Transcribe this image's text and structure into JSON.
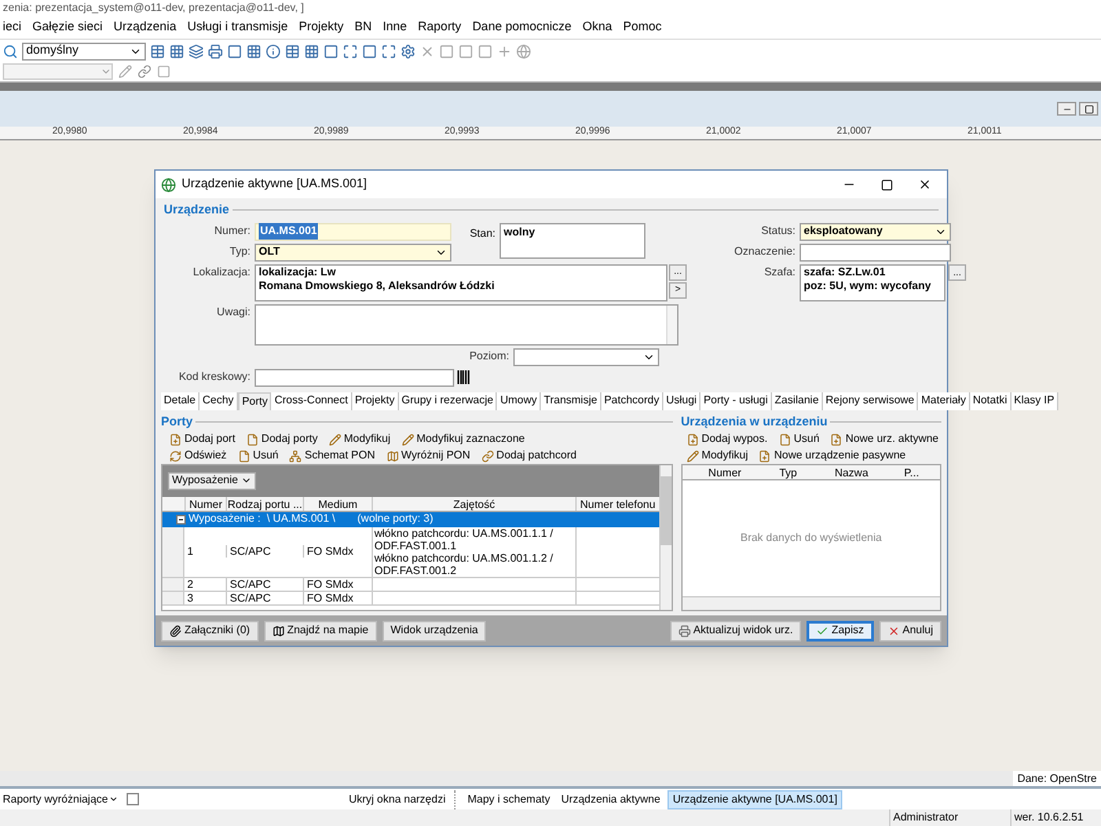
{
  "window": {
    "title": "zenia: prezentacja_system@o11-dev, prezentacja@o11-dev, ]"
  },
  "menu": [
    "ieci",
    "Gałęzie sieci",
    "Urządzenia",
    "Usługi i transmisje",
    "Projekty",
    "BN",
    "Inne",
    "Raporty",
    "Dane pomocnicze",
    "Okna",
    "Pomoc"
  ],
  "toolbar": {
    "profile": "domyślny"
  },
  "ruler": [
    "20,9980",
    "20,9984",
    "20,9989",
    "20,9993",
    "20,9996",
    "21,0002",
    "21,0007",
    "21,0011"
  ],
  "dialog": {
    "title": "Urządzenie aktywne [UA.MS.001]",
    "group": "Urządzenie",
    "fields": {
      "numer": {
        "label": "Numer:",
        "value": "UA.MS.001"
      },
      "typ": {
        "label": "Typ:",
        "value": "OLT"
      },
      "stan": {
        "label": "Stan:",
        "value": "wolny"
      },
      "status": {
        "label": "Status:",
        "value": "eksploatowany"
      },
      "oznaczenie": {
        "label": "Oznaczenie:"
      },
      "lokalizacja": {
        "label": "Lokalizacja:",
        "buttons": [
          "...",
          ">"
        ],
        "lines": [
          "lokalizacja: Lw",
          "Romana Dmowskiego 8, Aleksandrów Łódzki"
        ]
      },
      "szafa": {
        "label": "Szafa:",
        "button": "...",
        "lines": [
          "szafa: SZ.Lw.01",
          "poz: 5U,  wym: wycofany"
        ]
      },
      "uwagi": {
        "label": "Uwagi:"
      },
      "poziom": {
        "label": "Poziom:"
      },
      "kod": {
        "label": "Kod kreskowy:"
      }
    },
    "tabs": [
      {
        "label": "Detale",
        "selected": false
      },
      {
        "label": "Cechy",
        "selected": false
      },
      {
        "label": "Porty",
        "selected": true
      },
      {
        "label": "Cross-Connect",
        "selected": false
      },
      {
        "label": "Projekty",
        "selected": false
      },
      {
        "label": "Grupy i rezerwacje",
        "selected": false
      },
      {
        "label": "Umowy",
        "selected": false
      },
      {
        "label": "Transmisje",
        "selected": false
      },
      {
        "label": "Patchcordy",
        "selected": false
      },
      {
        "label": "Usługi",
        "selected": false
      },
      {
        "label": "Porty - usługi",
        "selected": false
      },
      {
        "label": "Zasilanie",
        "selected": false
      },
      {
        "label": "Rejony serwisowe",
        "selected": false
      },
      {
        "label": "Materiały",
        "selected": false
      },
      {
        "label": "Notatki",
        "selected": false
      },
      {
        "label": "Klasy IP",
        "selected": false
      }
    ],
    "ports": {
      "title": "Porty",
      "actions": [
        [
          "Dodaj port",
          "Dodaj porty",
          "Modyfikuj",
          "Modyfikuj zaznaczone"
        ],
        [
          "Odśwież",
          "Usuń",
          "Schemat PON",
          "Wyróżnij PON",
          "Dodaj patchcord"
        ]
      ],
      "group_by": "Wyposażenie",
      "columns": [
        "Numer",
        "Rodzaj portu ...",
        "Medium",
        "Zajętość",
        "Numer telefonu"
      ],
      "group_row": {
        "label": "Wyposażenie :  \\ UA.MS.001 \\",
        "free": "(wolne porty: 3)",
        "selected": true,
        "expanded": true
      },
      "rows": [
        {
          "numer": "1",
          "rodzaj": "SC/APC",
          "medium": "FO SMdx",
          "zajetosc": [
            "włókno patchcordu: UA.MS.001.1.1 / ODF.FAST.001.1",
            "włókno patchcordu: UA.MS.001.1.2 / ODF.FAST.001.2"
          ]
        },
        {
          "numer": "2",
          "rodzaj": "SC/APC",
          "medium": "FO SMdx",
          "zajetosc": []
        },
        {
          "numer": "3",
          "rodzaj": "SC/APC",
          "medium": "FO SMdx",
          "zajetosc": []
        }
      ]
    },
    "devices": {
      "title": "Urządzenia w urządzeniu",
      "actions": [
        [
          "Dodaj wypos.",
          "Usuń",
          "Nowe urz. aktywne"
        ],
        [
          "Modyfikuj",
          "Nowe urządzenie pasywne"
        ]
      ],
      "columns": [
        "Numer",
        "Typ",
        "Nazwa",
        "P..."
      ],
      "empty": "Brak danych do wyświetlenia"
    },
    "footer_left": [
      "Załączniki (0)",
      "Znajdź na mapie",
      "Widok urządzenia"
    ],
    "footer_right": [
      "Aktualizuj widok urz.",
      "Zapisz",
      "Anuluj"
    ]
  },
  "map_attribution": "Dane: OpenStre",
  "taskbar": {
    "reports": "Raporty wyróżniające",
    "checked": false,
    "hide": "Ukryj okna narzędzi",
    "items": [
      {
        "label": "Mapy i schematy",
        "selected": false
      },
      {
        "label": "Urządzenia aktywne",
        "selected": false
      },
      {
        "label": "Urządzenie aktywne [UA.MS.001]",
        "selected": true
      }
    ]
  },
  "status_bar": {
    "user": "Administrator",
    "version": "wer. 10.6.2.51"
  }
}
